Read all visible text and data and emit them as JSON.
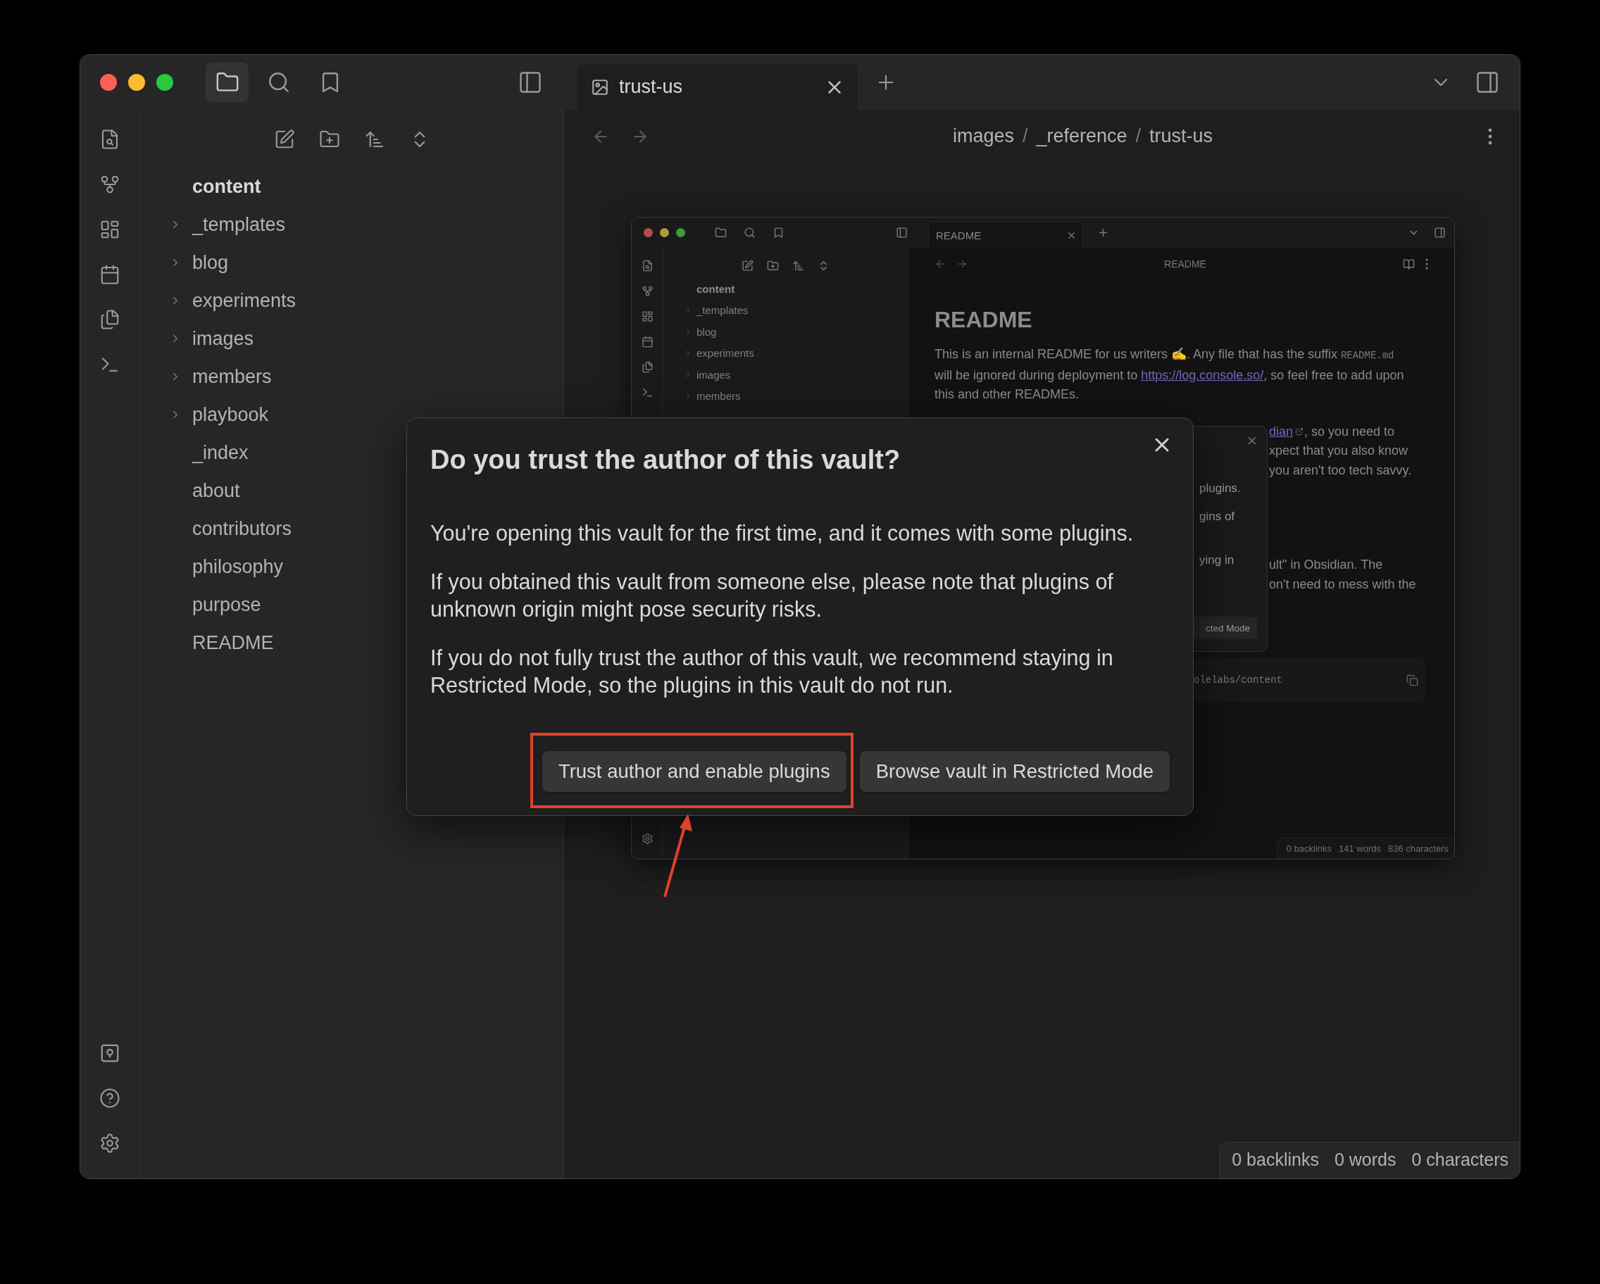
{
  "header_buttons": [
    {
      "kind": "files",
      "selected": true
    },
    {
      "kind": "search",
      "selected": false
    },
    {
      "kind": "bookmarks",
      "selected": false
    }
  ],
  "tabs": [
    {
      "title": "trust-us",
      "selected": true
    }
  ],
  "breadcrumb": {
    "parts": [
      "images",
      "_reference",
      "trust-us"
    ],
    "separator": "/"
  },
  "file_tree": {
    "root": "content",
    "items": [
      {
        "name": "_templates",
        "kind": "folder",
        "expanded": false
      },
      {
        "name": "blog",
        "kind": "folder",
        "expanded": false
      },
      {
        "name": "experiments",
        "kind": "folder",
        "expanded": false
      },
      {
        "name": "images",
        "kind": "folder",
        "expanded": false
      },
      {
        "name": "members",
        "kind": "folder",
        "expanded": false
      },
      {
        "name": "playbook",
        "kind": "folder",
        "expanded": false
      },
      {
        "name": "_index",
        "kind": "file"
      },
      {
        "name": "about",
        "kind": "file"
      },
      {
        "name": "contributors",
        "kind": "file"
      },
      {
        "name": "philosophy",
        "kind": "file"
      },
      {
        "name": "purpose",
        "kind": "file"
      },
      {
        "name": "README",
        "kind": "file"
      }
    ]
  },
  "embedded_screenshot": {
    "tabs": [
      {
        "title": "README",
        "selected": true
      }
    ],
    "note_title": "README",
    "file_tree": {
      "root": "content",
      "items": [
        {
          "name": "_templates",
          "kind": "folder",
          "expanded": false
        },
        {
          "name": "blog",
          "kind": "folder",
          "expanded": false
        },
        {
          "name": "experiments",
          "kind": "folder",
          "expanded": false
        },
        {
          "name": "images",
          "kind": "folder",
          "expanded": false
        },
        {
          "name": "members",
          "kind": "folder",
          "expanded": false
        }
      ]
    },
    "heading": "README",
    "intro": [
      {
        "kind": "text",
        "text": "This is an internal README for us writers ✍. Any file that has the suffix "
      },
      {
        "kind": "code",
        "text": "README.md"
      },
      {
        "kind": "text",
        "text": " will be ignored during deployment to "
      },
      {
        "kind": "link",
        "text": "https://log.console.so/"
      },
      {
        "kind": "text",
        "text": ", so feel free to add upon this and other READMEs."
      }
    ],
    "fragment_groups": [
      [
        [
          {
            "kind": "external_link",
            "text": "dian"
          },
          {
            "kind": "text",
            "text": ", so you need to"
          }
        ],
        [
          {
            "kind": "text",
            "text": "xpect that you also know"
          }
        ],
        [
          {
            "kind": "text",
            "text": "you aren't too tech savvy."
          }
        ]
      ],
      [
        [
          {
            "kind": "text",
            "text": "ult\" in Obsidian. The"
          }
        ],
        [
          {
            "kind": "text",
            "text": "on't need to mess with the"
          }
        ]
      ]
    ],
    "code_block": "olelabs/content",
    "dialog": {
      "lines": [
        "plugins.",
        "gins of",
        "ying in"
      ],
      "button": "cted Mode"
    },
    "status_bar": [
      "0 backlinks",
      "141 words",
      "836 characters"
    ]
  },
  "dialog": {
    "title": "Do you trust the author of this vault?",
    "paragraphs": [
      "You're opening this vault for the first time, and it comes with some plugins.",
      "If you obtained this vault from someone else, please note that plugins of unknown origin might pose security risks.",
      "If you do not fully trust the author of this vault, we recommend staying in Restricted Mode, so the plugins in this vault do not run."
    ],
    "buttons": [
      {
        "label": "Trust author and enable plugins",
        "highlighted": true
      },
      {
        "label": "Browse vault in Restricted Mode",
        "highlighted": false
      }
    ]
  },
  "status_bar": [
    "0 backlinks",
    "0 words",
    "0 characters"
  ]
}
